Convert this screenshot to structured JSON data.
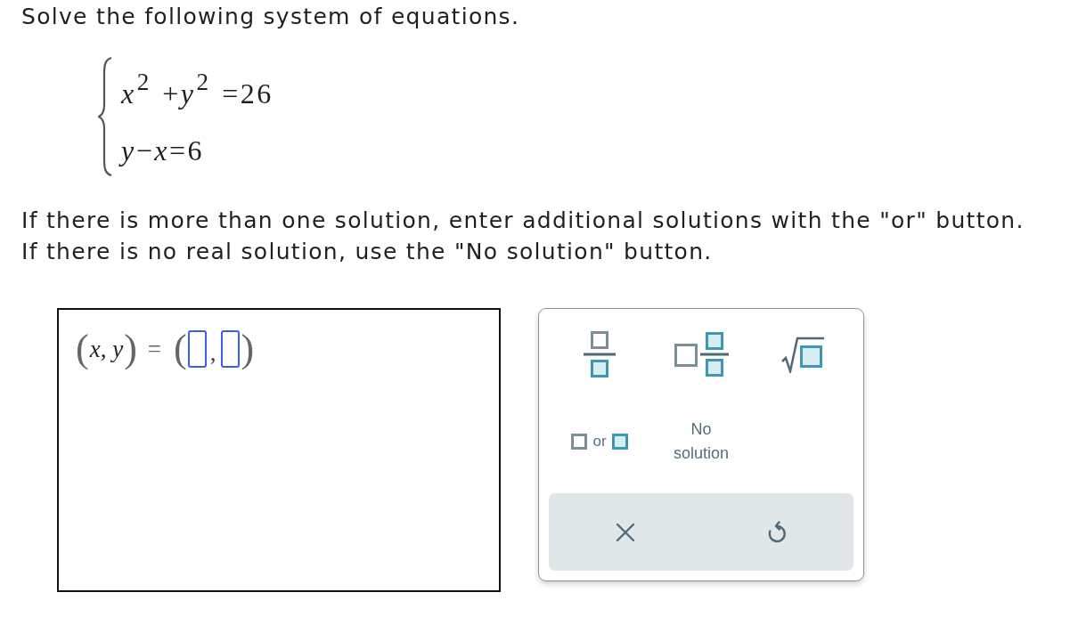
{
  "prompt": "Solve the following system of equations.",
  "system": {
    "equations": [
      "*x*$^{2}$ +*y*$^{2}$ =26",
      "*y*−*x*=6"
    ]
  },
  "instructions": [
    "If there is more than one solution, enter additional solutions with the \"or\" button.",
    "If there is no real solution, use the \"No solution\" button."
  ],
  "answer": {
    "parts": [
      {
        "kind": "paren",
        "text": "("
      },
      {
        "kind": "math",
        "text": "*x*, *y*"
      },
      {
        "kind": "paren",
        "text": ")"
      },
      {
        "kind": "operator",
        "text": "="
      },
      {
        "kind": "paren",
        "text": "("
      },
      {
        "kind": "field"
      },
      {
        "kind": "separator",
        "text": ","
      },
      {
        "kind": "field"
      },
      {
        "kind": "paren",
        "text": ")"
      }
    ]
  },
  "keypad": {
    "keys": [
      {
        "kind": "fraction"
      },
      {
        "kind": "mixed-number"
      },
      {
        "kind": "square-root"
      },
      {
        "kind": "or",
        "label": "or"
      },
      {
        "kind": "no-solution",
        "label": "No solution"
      }
    ],
    "actions": [
      {
        "kind": "clear"
      },
      {
        "kind": "undo"
      }
    ]
  }
}
